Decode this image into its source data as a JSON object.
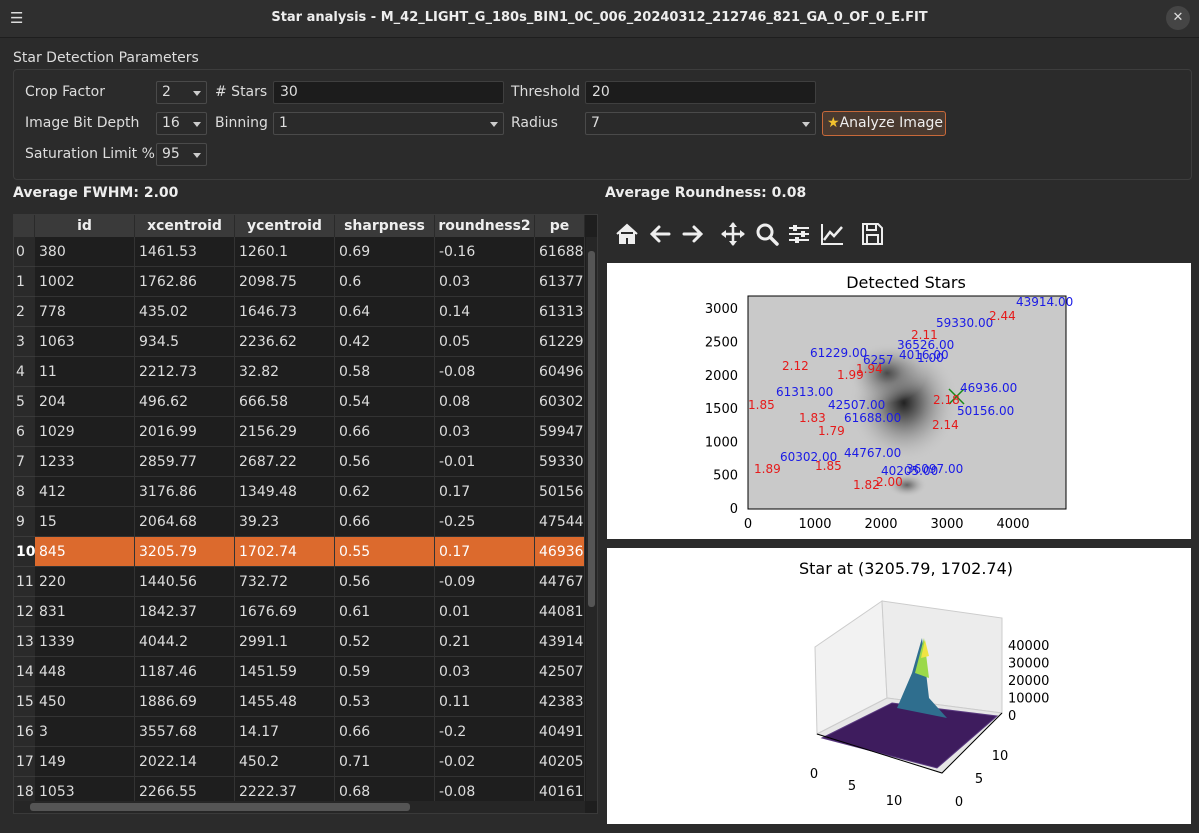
{
  "window": {
    "title": "Star analysis - M_42_LIGHT_G_180s_BIN1_0C_006_20240312_212746_821_GA_0_OF_0_E.FIT"
  },
  "params": {
    "group_title": "Star Detection Parameters",
    "crop_label": "Crop Factor",
    "crop_value": "2",
    "stars_label": "# Stars",
    "stars_value": "30",
    "threshold_label": "Threshold",
    "threshold_value": "20",
    "bitdepth_label": "Image Bit Depth",
    "bitdepth_value": "16",
    "binning_label": "Binning",
    "binning_value": "1",
    "radius_label": "Radius",
    "radius_value": "7",
    "saturation_label": "Saturation Limit %",
    "saturation_value": "95",
    "analyze_label": "Analyze Image"
  },
  "summary": {
    "fwhm": "Average FWHM: 2.00",
    "roundness": "Average Roundness: 0.08"
  },
  "table": {
    "columns": [
      "id",
      "xcentroid",
      "ycentroid",
      "sharpness",
      "roundness2",
      "pe"
    ],
    "selected_row": 10,
    "rows": [
      [
        "0",
        "380",
        "1461.53",
        "1260.1",
        "0.69",
        "-0.16",
        "61688."
      ],
      [
        "1",
        "1002",
        "1762.86",
        "2098.75",
        "0.6",
        "0.03",
        "61377."
      ],
      [
        "2",
        "778",
        "435.02",
        "1646.73",
        "0.64",
        "0.14",
        "61313."
      ],
      [
        "3",
        "1063",
        "934.5",
        "2236.62",
        "0.42",
        "0.05",
        "61229."
      ],
      [
        "4",
        "11",
        "2212.73",
        "32.82",
        "0.58",
        "-0.08",
        "60496."
      ],
      [
        "5",
        "204",
        "496.62",
        "666.58",
        "0.54",
        "0.08",
        "60302."
      ],
      [
        "6",
        "1029",
        "2016.99",
        "2156.29",
        "0.66",
        "0.03",
        "59947."
      ],
      [
        "7",
        "1233",
        "2859.77",
        "2687.22",
        "0.56",
        "-0.01",
        "59330."
      ],
      [
        "8",
        "412",
        "3176.86",
        "1349.48",
        "0.62",
        "0.17",
        "50156."
      ],
      [
        "9",
        "15",
        "2064.68",
        "39.23",
        "0.66",
        "-0.25",
        "47544."
      ],
      [
        "10",
        "845",
        "3205.79",
        "1702.74",
        "0.55",
        "0.17",
        "46936."
      ],
      [
        "11",
        "220",
        "1440.56",
        "732.72",
        "0.56",
        "-0.09",
        "44767."
      ],
      [
        "12",
        "831",
        "1842.37",
        "1676.69",
        "0.61",
        "0.01",
        "44081."
      ],
      [
        "13",
        "1339",
        "4044.2",
        "2991.1",
        "0.52",
        "0.21",
        "43914."
      ],
      [
        "14",
        "448",
        "1187.46",
        "1451.59",
        "0.59",
        "0.03",
        "42507."
      ],
      [
        "15",
        "450",
        "1886.69",
        "1455.48",
        "0.53",
        "0.11",
        "42383."
      ],
      [
        "16",
        "3",
        "3557.68",
        "14.17",
        "0.66",
        "-0.2",
        "40491."
      ],
      [
        "17",
        "149",
        "2022.14",
        "450.2",
        "0.71",
        "-0.02",
        "40205."
      ],
      [
        "18",
        "1053",
        "2266.55",
        "2222.37",
        "0.68",
        "-0.08",
        "40161."
      ]
    ]
  },
  "toolbar": [
    "home-icon",
    "back-arrow-icon",
    "forward-arrow-icon",
    "pan-icon",
    "zoom-icon",
    "configure-subplots-icon",
    "edit-axis-icon",
    "save-icon"
  ],
  "plot1": {
    "title": "Detected Stars",
    "xticks": [
      "0",
      "1000",
      "2000",
      "3000",
      "4000"
    ],
    "yticks": [
      "0",
      "500",
      "1000",
      "1500",
      "2000",
      "2500",
      "3000"
    ],
    "blue_labels": [
      "43914.00",
      "59330.00",
      "36526.00",
      "61229.00",
      "4016.00",
      "6257",
      "1.00",
      "46936.00",
      "61313.00",
      "42507.00",
      "50156.00",
      "61688.00",
      "44767.00",
      "60302.00",
      "40205.00",
      "36097.00"
    ],
    "red_labels": [
      "2.44",
      "2.11",
      "2.12",
      "1.99",
      "1.94",
      "1.85",
      "2.18",
      "1.83",
      "2.14",
      "1.79",
      "1.89",
      "1.85",
      "1.82",
      "2.00"
    ]
  },
  "plot2": {
    "title": "Star at (3205.79, 1702.74)",
    "zticks": [
      "40000",
      "30000",
      "20000",
      "10000",
      "0"
    ],
    "xticks": [
      "0",
      "5",
      "10"
    ],
    "yticks": [
      "0",
      "5",
      "10"
    ]
  }
}
